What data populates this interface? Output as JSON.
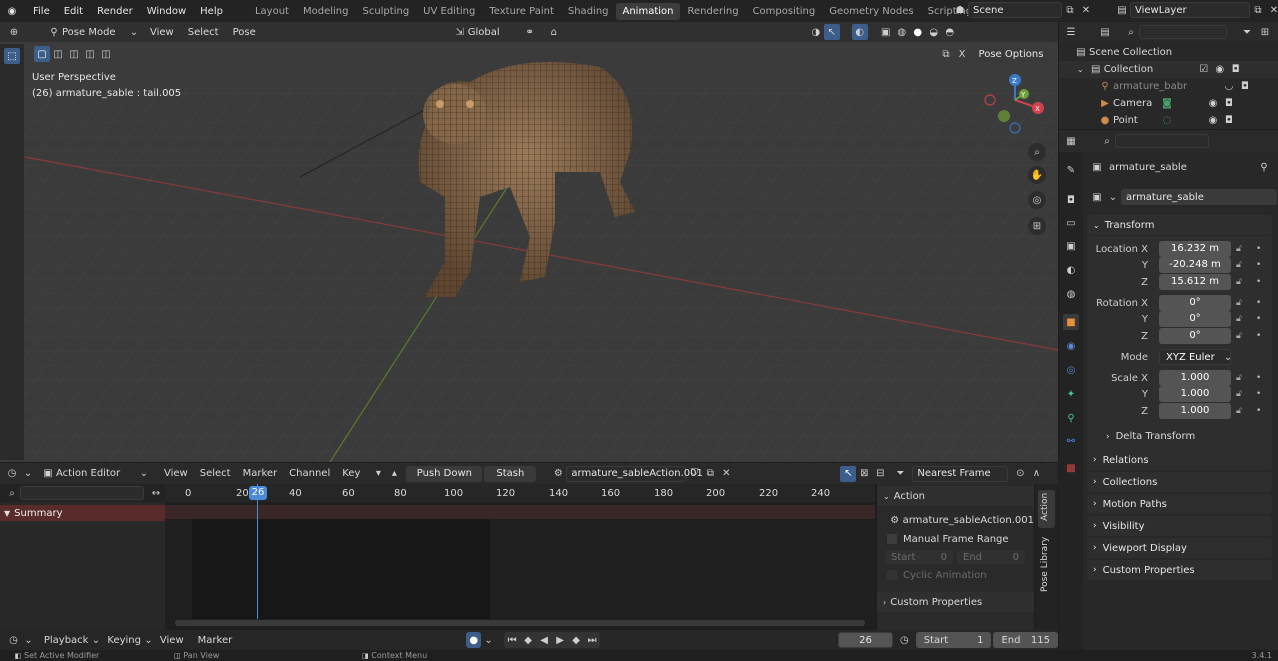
{
  "menu": [
    "File",
    "Edit",
    "Render",
    "Window",
    "Help"
  ],
  "workspaces": [
    "Layout",
    "Modeling",
    "Sculpting",
    "UV Editing",
    "Texture Paint",
    "Shading",
    "Animation",
    "Rendering",
    "Compositing",
    "Geometry Nodes",
    "Scripting"
  ],
  "active_workspace": "Animation",
  "scene_name": "Scene",
  "view_layer": "ViewLayer",
  "viewport": {
    "mode": "Pose Mode",
    "menus": [
      "View",
      "Select",
      "Pose"
    ],
    "orientation": "Global",
    "overlay_title": "User Perspective",
    "overlay_subtitle": "(26) armature_sable : tail.005",
    "pose_options": "Pose Options",
    "gizmo": {
      "x": "X",
      "y": "Y",
      "z": "Z"
    }
  },
  "outliner": {
    "root": "Scene Collection",
    "items": [
      {
        "label": "Collection",
        "level": 1
      },
      {
        "label": "armature_babr",
        "level": 2
      },
      {
        "label": "Camera",
        "level": 2
      },
      {
        "label": "Point",
        "level": 2
      }
    ]
  },
  "properties": {
    "object_name": "armature_sable",
    "data_name": "armature_sable",
    "transform_title": "Transform",
    "location_label": "Location X",
    "location": [
      "16.232 m",
      "-20.248 m",
      "15.612 m"
    ],
    "rotation_label": "Rotation X",
    "rotation": [
      "0°",
      "0°",
      "0°"
    ],
    "mode_label": "Mode",
    "mode_value": "XYZ Euler",
    "scale_label": "Scale X",
    "scale": [
      "1.000",
      "1.000",
      "1.000"
    ],
    "axis_y": "Y",
    "axis_z": "Z",
    "delta": "Delta Transform",
    "panels": [
      "Relations",
      "Collections",
      "Motion Paths",
      "Visibility",
      "Viewport Display",
      "Custom Properties"
    ]
  },
  "action_editor": {
    "editor_type": "Action Editor",
    "menus": [
      "View",
      "Select",
      "Marker",
      "Channel",
      "Key"
    ],
    "push_down": "Push Down",
    "stash": "Stash",
    "action_name": "armature_sableAction.001",
    "snap": "Nearest Frame",
    "frame_ticks": [
      "0",
      "20",
      "40",
      "60",
      "80",
      "100",
      "120",
      "140",
      "160",
      "180",
      "200",
      "220",
      "240"
    ],
    "current_frame": "26",
    "summary": "Summary",
    "side_title": "Action",
    "side_action": "armature_sableAction.001",
    "manual_range": "Manual Frame Range",
    "start_label": "Start",
    "start_val": "0",
    "end_label": "End",
    "end_val": "0",
    "cyclic": "Cyclic Animation",
    "custom_props": "Custom Properties",
    "tabs": [
      "Action",
      "Pose Library"
    ]
  },
  "timeline": {
    "menus": [
      "Playback",
      "Keying",
      "View",
      "Marker"
    ],
    "current_frame": "26",
    "start_label": "Start",
    "start": "1",
    "end_label": "End",
    "end": "115"
  },
  "status": {
    "left": "Set Active Modifier",
    "mid": "Pan View",
    "right": "Context Menu",
    "version": "3.4.1"
  }
}
